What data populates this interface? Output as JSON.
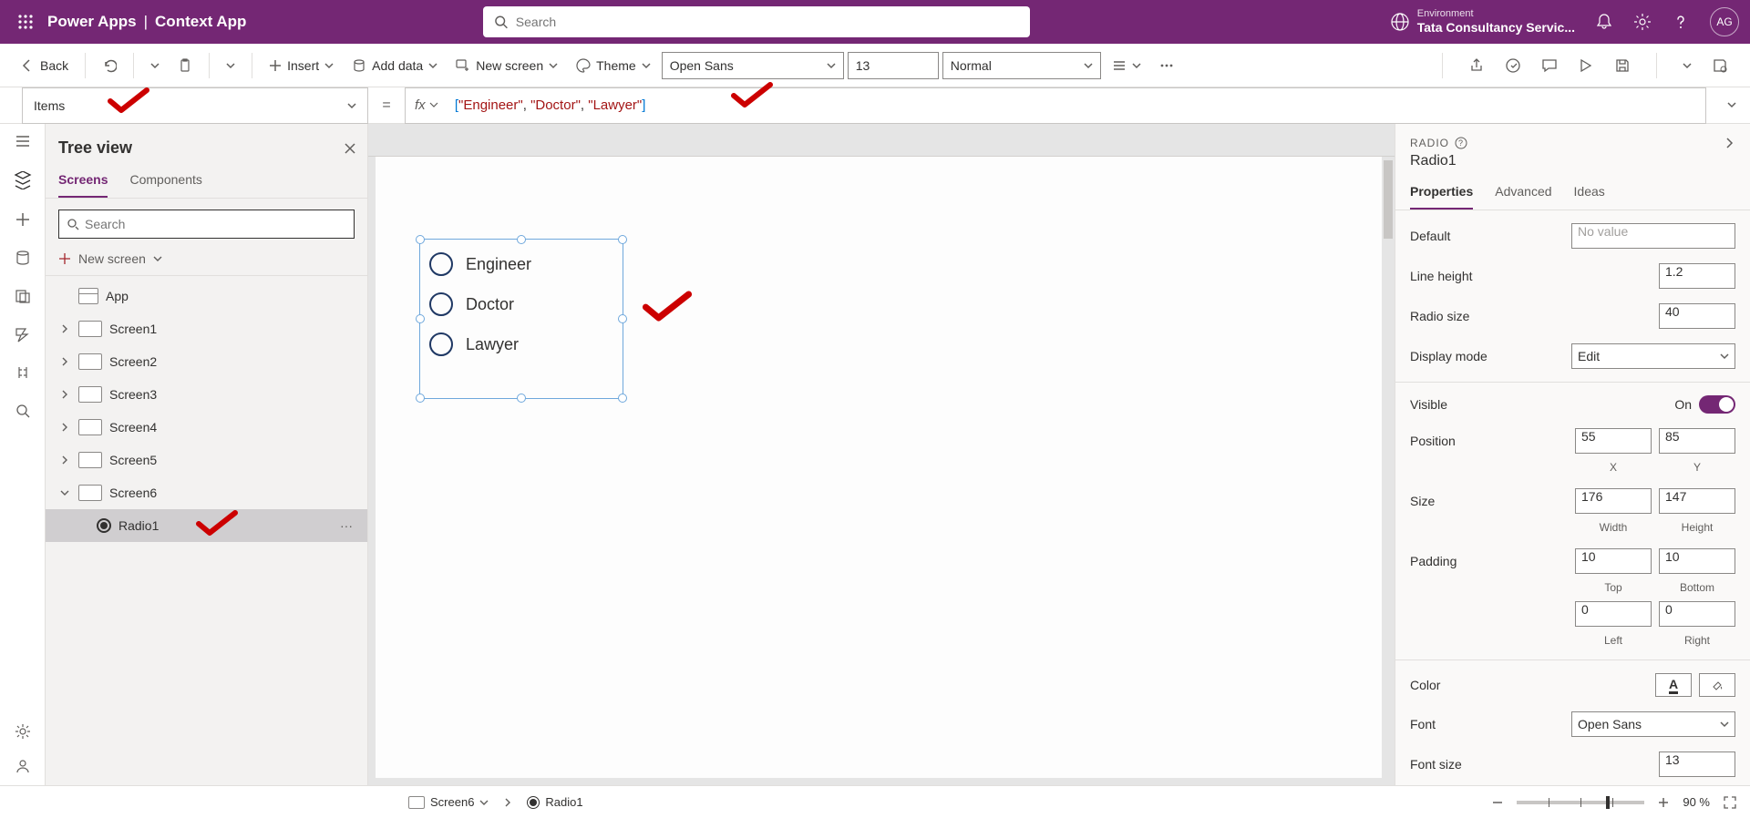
{
  "header": {
    "app_name": "Power Apps",
    "context_name": "Context App",
    "search_placeholder": "Search",
    "environment_label": "Environment",
    "environment_name": "Tata Consultancy Servic...",
    "avatar_initials": "AG"
  },
  "cmdbar": {
    "back": "Back",
    "insert": "Insert",
    "add_data": "Add data",
    "new_screen": "New screen",
    "theme": "Theme",
    "font_name": "Open Sans",
    "font_size": "13",
    "font_weight": "Normal"
  },
  "formula": {
    "property": "Items",
    "fx": "fx"
  },
  "formula_tokens": [
    "[",
    "\"Engineer\"",
    ", ",
    "\"Doctor\"",
    ", ",
    "\"Lawyer\"",
    "]"
  ],
  "tree": {
    "title": "Tree view",
    "tab_screens": "Screens",
    "tab_components": "Components",
    "search_placeholder": "Search",
    "new_screen": "New screen",
    "app": "App",
    "items": [
      "Screen1",
      "Screen2",
      "Screen3",
      "Screen4",
      "Screen5",
      "Screen6"
    ],
    "radio_item": "Radio1"
  },
  "radio_options": [
    "Engineer",
    "Doctor",
    "Lawyer"
  ],
  "breadcrumb": {
    "screen": "Screen6",
    "control": "Radio1"
  },
  "zoom": "90  %",
  "props": {
    "control_type": "RADIO",
    "control_name": "Radio1",
    "tabs": {
      "properties": "Properties",
      "advanced": "Advanced",
      "ideas": "Ideas"
    },
    "default_label": "Default",
    "default_value": "No value",
    "line_height_label": "Line height",
    "line_height_value": "1.2",
    "radio_size_label": "Radio size",
    "radio_size_value": "40",
    "display_mode_label": "Display mode",
    "display_mode_value": "Edit",
    "visible_label": "Visible",
    "visible_text": "On",
    "position_label": "Position",
    "pos_x": "55",
    "pos_y": "85",
    "x_label": "X",
    "y_label": "Y",
    "size_label": "Size",
    "width": "176",
    "height": "147",
    "width_label": "Width",
    "height_label": "Height",
    "padding_label": "Padding",
    "pad_top": "10",
    "pad_bottom": "10",
    "pad_left": "0",
    "pad_right": "0",
    "top_label": "Top",
    "bottom_label": "Bottom",
    "left_label": "Left",
    "right_label": "Right",
    "color_label": "Color",
    "font_label": "Font",
    "font_value": "Open Sans",
    "font_size_label": "Font size",
    "font_size_value": "13"
  }
}
